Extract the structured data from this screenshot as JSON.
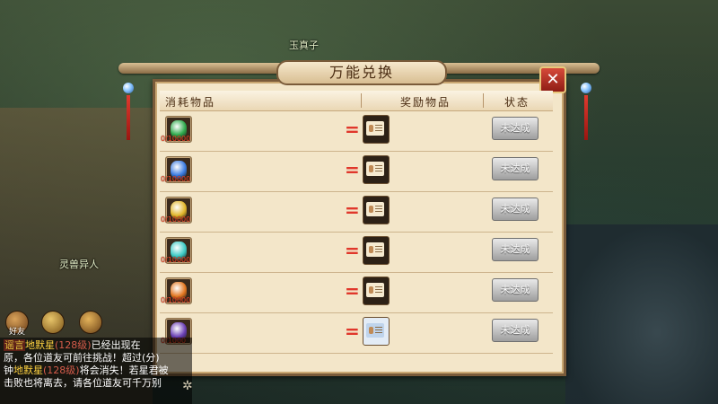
{
  "scene": {
    "npc_top_name": "玉真子",
    "npc_left_name": "灵兽异人"
  },
  "dialog": {
    "title": "万能兑换",
    "close_icon": "close-x-icon",
    "headers": {
      "consume": "消耗物品",
      "reward": "奖励物品",
      "status": "状态"
    },
    "equals": "=",
    "rows": [
      {
        "item_icon": "green-pet-egg-icon",
        "count": "0/10000",
        "gem_color": "#2faa4c",
        "reward_icon": "identity-card-icon",
        "status": "未达成"
      },
      {
        "item_icon": "blue-pet-egg-icon",
        "count": "0/10000",
        "gem_color": "#3b7be0",
        "reward_icon": "identity-card-icon",
        "status": "未达成"
      },
      {
        "item_icon": "gold-pet-egg-icon",
        "count": "0/10000",
        "gem_color": "#e0b52a",
        "reward_icon": "identity-card-icon",
        "status": "未达成"
      },
      {
        "item_icon": "cyan-pet-egg-icon",
        "count": "0/10000",
        "gem_color": "#3cc9c4",
        "reward_icon": "identity-card-icon",
        "status": "未达成"
      },
      {
        "item_icon": "orange-pet-egg-icon",
        "count": "0/10000",
        "gem_color": "#e2761f",
        "reward_icon": "identity-card-icon",
        "status": "未达成"
      },
      {
        "item_icon": "purple-orb-icon",
        "count": "0/1000",
        "gem_color": "#6a3fb5",
        "reward_icon": "shield-badge-icon",
        "status": "未达成"
      }
    ]
  },
  "toolbar": {
    "friends_label": "好友",
    "voice_label": "语音"
  },
  "chat": {
    "line1_tag": "谣言",
    "line1_star": "地默星",
    "line1_lvl": "(128级)",
    "line1_rest": "已经出现在",
    "line2": "原，各位道友可前往挑战！超过(分)",
    "line3_pre": "钟",
    "line3_star": "地默星",
    "line3_lvl": "(128级)",
    "line3_rest": "将会消失！若星君被",
    "line4": "击败也将离去，请各位道友可千万别"
  }
}
